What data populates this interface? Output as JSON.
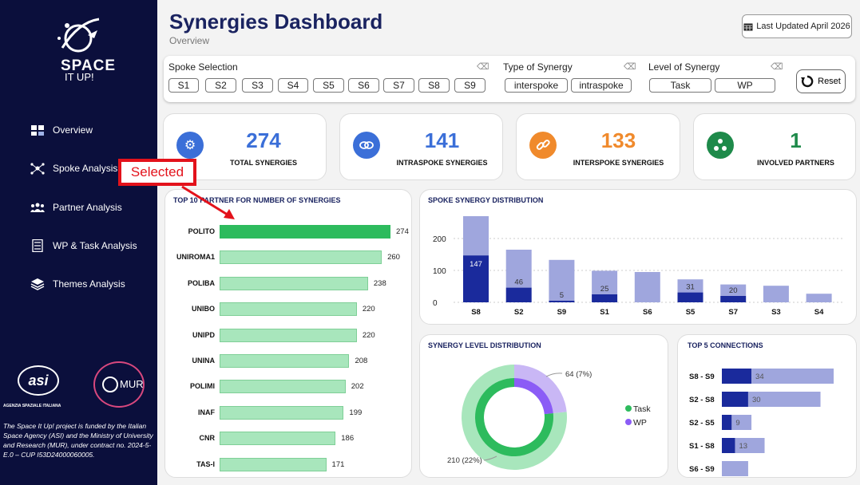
{
  "app": {
    "title": "Synergies Dashboard",
    "subtitle": "Overview",
    "last_updated": "Last Updated April 2026"
  },
  "sidebar": {
    "logo_text_main": "SPACE",
    "logo_text_sub": "IT UP!",
    "items": [
      {
        "label": "Overview",
        "icon": "puzzle-icon"
      },
      {
        "label": "Spoke Analysis",
        "icon": "network-icon"
      },
      {
        "label": "Partner Analysis",
        "icon": "people-icon"
      },
      {
        "label": "WP & Task Analysis",
        "icon": "checklist-icon"
      },
      {
        "label": "Themes Analysis",
        "icon": "layers-icon"
      }
    ],
    "asi_logo_text": "asi",
    "asi_caption": "AGENZIA SPAZIALE ITALIANA",
    "mur_logo_text": "MUR",
    "funding_text": "The Space It Up! project is funded by the Italian Space Agency (ASI) and the Ministry of University and Research (MUR), under contract no. 2024-5-E.0 – CUP I53D24000060005."
  },
  "filters": {
    "spoke_label": "Spoke Selection",
    "spokes": [
      "S1",
      "S2",
      "S3",
      "S4",
      "S5",
      "S6",
      "S7",
      "S8",
      "S9"
    ],
    "type_label": "Type of Synergy",
    "types": [
      "interspoke",
      "intraspoke"
    ],
    "level_label": "Level of Synergy",
    "levels": [
      "Task",
      "WP"
    ],
    "reset_label": "Reset"
  },
  "kpis": [
    {
      "value": "274",
      "label": "TOTAL SYNERGIES",
      "color": "#3b6fd8",
      "icon": "gears-icon"
    },
    {
      "value": "141",
      "label": "INTRASPOKE SYNERGIES",
      "color": "#3b6fd8",
      "icon": "link-loop-icon"
    },
    {
      "value": "133",
      "label": "INTERSPOKE SYNERGIES",
      "color": "#f08a2c",
      "icon": "chain-icon"
    },
    {
      "value": "1",
      "label": "INVOLVED PARTNERS",
      "color": "#1e8a4a",
      "icon": "group-icon"
    }
  ],
  "annotation": {
    "label": "Selected"
  },
  "chart_data": [
    {
      "type": "bar",
      "title": "TOP 10 PARTNER FOR NUMBER OF SYNERGIES",
      "orientation": "horizontal",
      "categories": [
        "POLITO",
        "UNIROMA1",
        "POLIBA",
        "UNIBO",
        "UNIPD",
        "UNINA",
        "POLIMI",
        "INAF",
        "CNR",
        "TAS-I"
      ],
      "values": [
        274,
        260,
        238,
        220,
        220,
        208,
        202,
        199,
        186,
        171
      ],
      "highlight": "POLITO",
      "colors": {
        "highlight": "#2dbb5d",
        "default": "#a8e6bc"
      }
    },
    {
      "type": "bar",
      "title": "SPOKE SYNERGY DISTRIBUTION",
      "stacked": true,
      "categories": [
        "S8",
        "S2",
        "S9",
        "S1",
        "S6",
        "S5",
        "S7",
        "S3",
        "S4"
      ],
      "series": [
        {
          "values": [
            147,
            46,
            5,
            25,
            0,
            31,
            20,
            0,
            0
          ],
          "color": "#1a2a9c"
        },
        {
          "values": [
            123,
            119,
            128,
            74,
            95,
            41,
            36,
            52,
            27
          ],
          "color": "#9fa6dd"
        }
      ],
      "data_labels": [
        "147",
        "46",
        "5",
        "25",
        "",
        "31",
        "20",
        "",
        ""
      ],
      "yticks": [
        0,
        100,
        200
      ],
      "ylim": [
        0,
        280
      ]
    },
    {
      "type": "pie",
      "title": "SYNERGY LEVEL DISTRIBUTION",
      "donut": true,
      "outer_ring": {
        "labels": [
          "Task",
          "WP"
        ],
        "values": [
          210,
          64
        ],
        "display": [
          "210 (22%)",
          "64 (7%)"
        ]
      },
      "legend": [
        {
          "name": "Task",
          "color": "#2dbb5d"
        },
        {
          "name": "WP",
          "color": "#8b5cf6"
        }
      ],
      "colors": {
        "outer_task": "#a8e6bc",
        "outer_wp": "#c9b7f5",
        "inner_task": "#2dbb5d",
        "inner_wp": "#8b5cf6"
      }
    },
    {
      "type": "bar",
      "title": "TOP 5 CONNECTIONS",
      "orientation": "horizontal",
      "stacked": true,
      "categories": [
        "S8 - S9",
        "S2 - S8",
        "S2 - S5",
        "S1 - S8",
        "S6 - S9"
      ],
      "series": [
        {
          "values": [
            9,
            8,
            3,
            4,
            0
          ],
          "color": "#1a2a9c"
        },
        {
          "values": [
            25,
            22,
            6,
            9,
            8
          ],
          "color": "#9fa6dd"
        }
      ],
      "data_labels": [
        "34",
        "30",
        "9",
        "13",
        ""
      ],
      "xlim": [
        0,
        34
      ]
    }
  ]
}
